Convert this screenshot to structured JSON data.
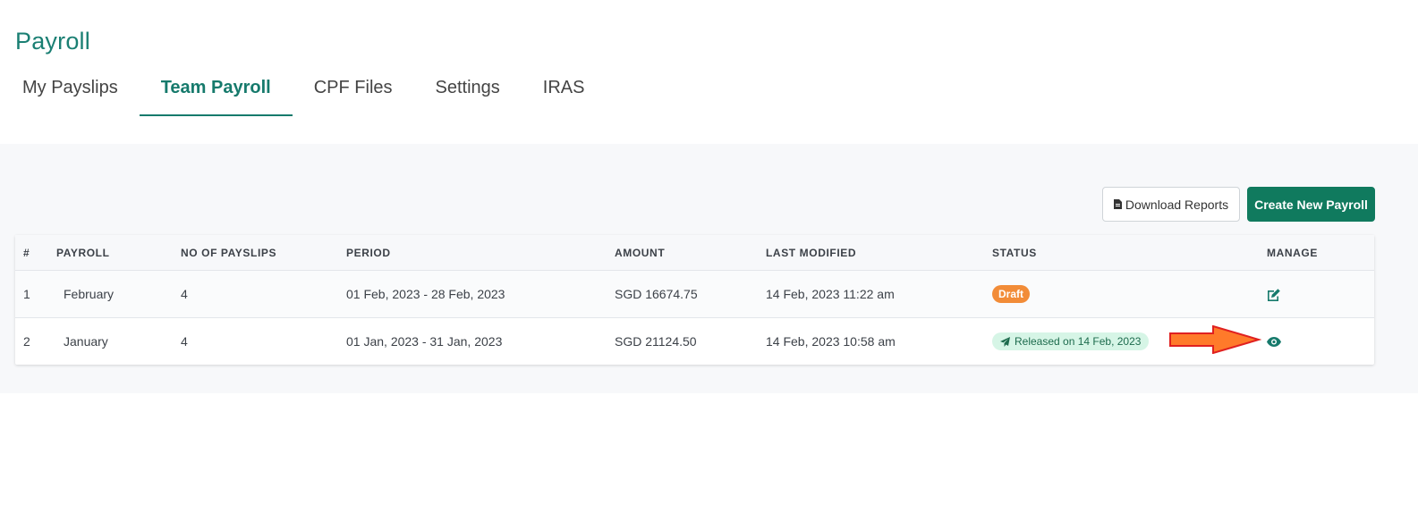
{
  "page": {
    "title": "Payroll"
  },
  "tabs": [
    {
      "label": "My Payslips",
      "active": false
    },
    {
      "label": "Team Payroll",
      "active": true
    },
    {
      "label": "CPF Files",
      "active": false
    },
    {
      "label": "Settings",
      "active": false
    },
    {
      "label": "IRAS",
      "active": false
    }
  ],
  "toolbar": {
    "download_label": "Download Reports",
    "create_label": "Create New Payroll"
  },
  "table": {
    "headers": {
      "index": "#",
      "payroll": "PAYROLL",
      "payslips": "NO OF PAYSLIPS",
      "period": "PERIOD",
      "amount": "AMOUNT",
      "modified": "LAST MODIFIED",
      "status": "STATUS",
      "manage": "MANAGE"
    },
    "rows": [
      {
        "index": "1",
        "payroll": "February",
        "payslips": "4",
        "period": "01 Feb, 2023 - 28 Feb, 2023",
        "amount": "SGD 16674.75",
        "modified": "14 Feb, 2023 11:22 am",
        "status": "Draft",
        "manage_icon": "edit-icon"
      },
      {
        "index": "2",
        "payroll": "January",
        "payslips": "4",
        "period": "01 Jan, 2023 - 31 Jan, 2023",
        "amount": "SGD 21124.50",
        "modified": "14 Feb, 2023 10:58 am",
        "status": "Released on 14 Feb, 2023",
        "manage_icon": "eye-icon"
      }
    ]
  },
  "colors": {
    "accent": "#167a6c",
    "primary_button": "#107a5e",
    "draft_badge": "#f28c38",
    "released_badge_bg": "#d6f5e6",
    "annotation_arrow": "#ff7a2a"
  }
}
